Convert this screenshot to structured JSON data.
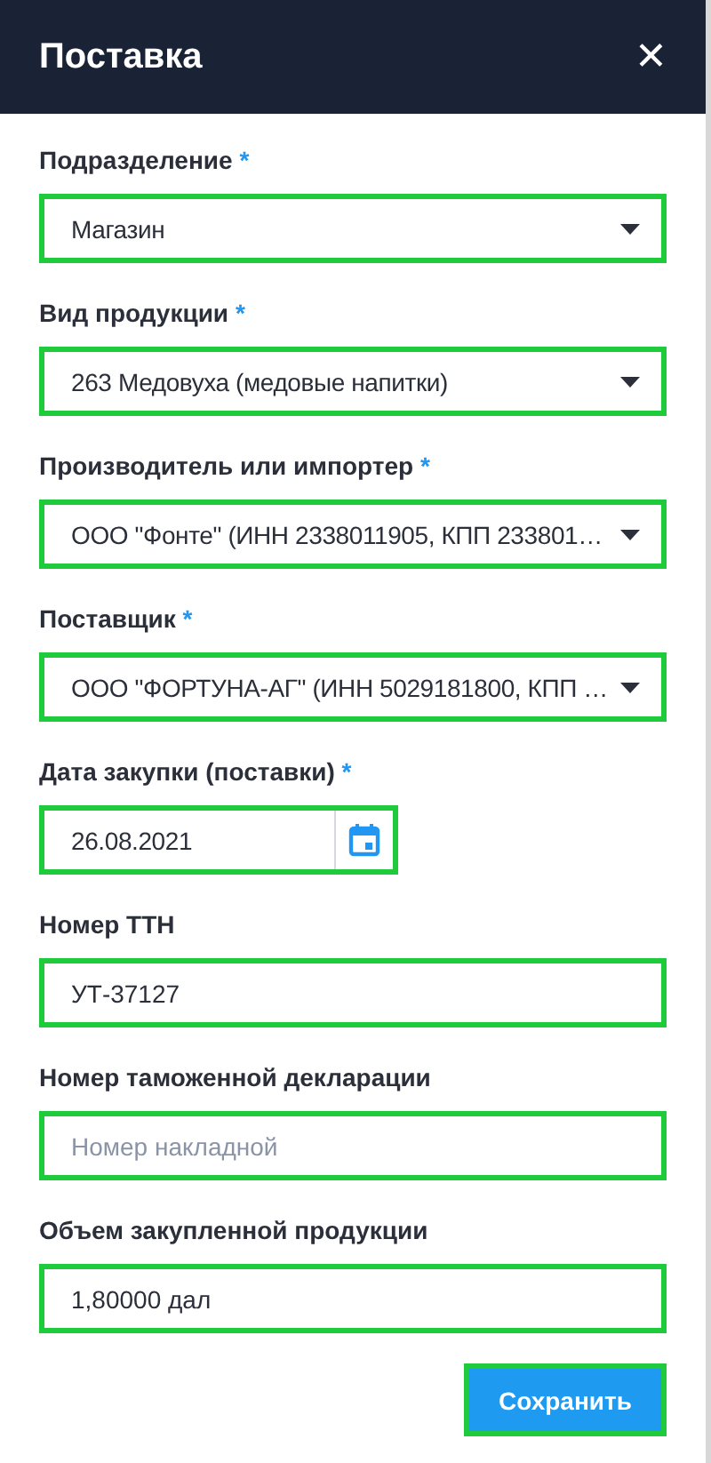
{
  "window": {
    "title": "Поставка",
    "close": "✕"
  },
  "fields": [
    {
      "kind": "select",
      "label": "Подразделение",
      "required_mark": "*",
      "value": "Магазин"
    },
    {
      "kind": "select",
      "label": "Вид продукции",
      "required_mark": "*",
      "value": "263 Медовуха (медовые напитки)"
    },
    {
      "kind": "select",
      "label": "Производитель или импортер",
      "required_mark": "*",
      "value": "ООО \"Фонте\" (ИНН 2338011905, КПП 233801…"
    },
    {
      "kind": "select",
      "label": "Поставщик",
      "required_mark": "*",
      "value": "ООО \"ФОРТУНА-АГ\" (ИНН 5029181800, КПП …"
    },
    {
      "kind": "date",
      "label": "Дата закупки (поставки)",
      "required_mark": "*",
      "value": "26.08.2021"
    },
    {
      "kind": "text",
      "label": "Номер ТТН",
      "value": "УТ-37127"
    },
    {
      "kind": "text",
      "label": "Номер таможенной декларации",
      "placeholder": "Номер накладной"
    },
    {
      "kind": "text",
      "label": "Объем закупленной продукции",
      "value": "1,80000 дал"
    }
  ],
  "buttons": [
    "Сохранить"
  ]
}
